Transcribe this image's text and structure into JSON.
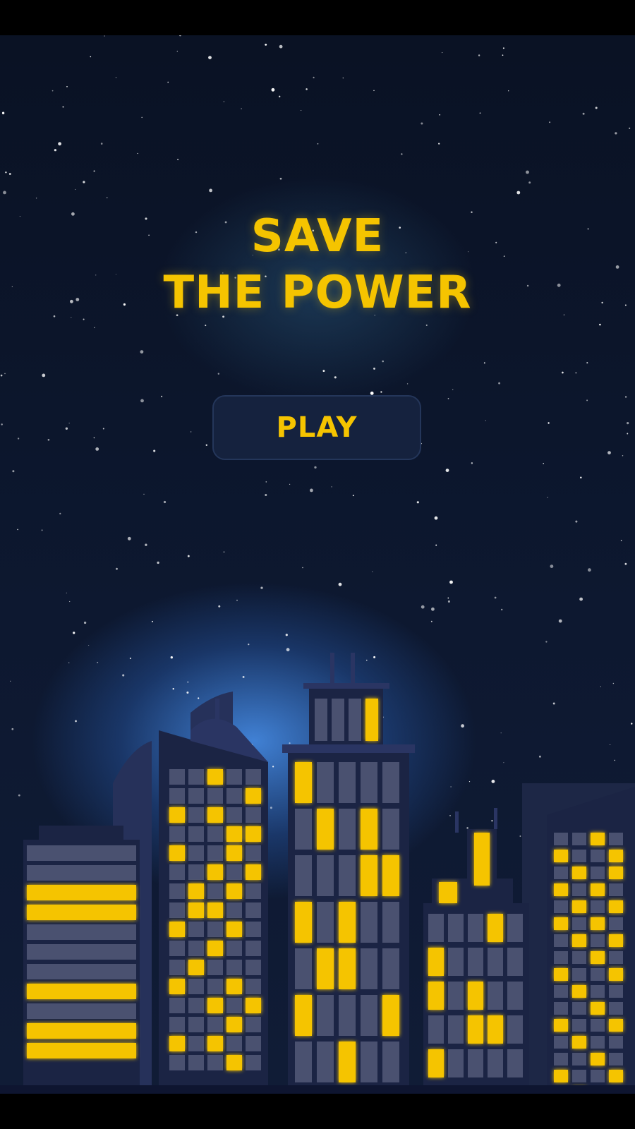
{
  "game": {
    "title_line1": "SAVE",
    "title_line2": "THE POWER",
    "play_label": "PLAY"
  },
  "colors": {
    "window_lit": "#f5c400",
    "window_dark": "#4a5170",
    "sky": "#0d1830",
    "building": "#1b2444"
  }
}
